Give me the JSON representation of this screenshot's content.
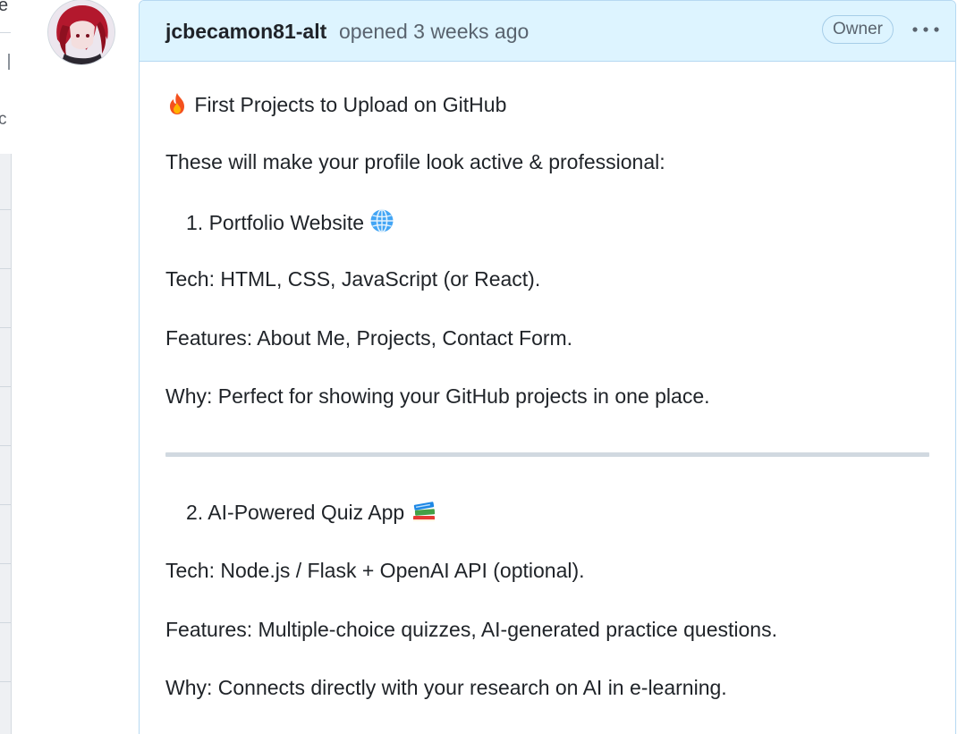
{
  "comment": {
    "author": "jcbecamon81-alt",
    "opened_text": "opened 3 weeks ago",
    "badge": "Owner"
  },
  "body": {
    "heading": "First Projects to Upload on GitHub",
    "intro": "These will make your profile look active & professional:",
    "project1": {
      "title": "1. Portfolio Website",
      "tech": "Tech: HTML, CSS, JavaScript (or React).",
      "features": "Features: About Me, Projects, Contact Form.",
      "why": "Why: Perfect for showing your GitHub projects in one place."
    },
    "project2": {
      "title": "2. AI-Powered Quiz App",
      "tech": "Tech: Node.js / Flask + OpenAI API (optional).",
      "features": "Features: Multiple-choice quizzes, AI-generated practice questions.",
      "why": "Why: Connects directly with your research on AI in e-learning."
    }
  },
  "icons": {
    "heading_emoji": "fire-icon",
    "project1_emoji": "globe-icon",
    "project2_emoji": "books-icon",
    "menu": "kebab-menu-icon"
  },
  "colors": {
    "header_bg": "#ddf4ff",
    "card_border": "#b6d9f2",
    "text": "#1f2328",
    "muted": "#59636e"
  }
}
